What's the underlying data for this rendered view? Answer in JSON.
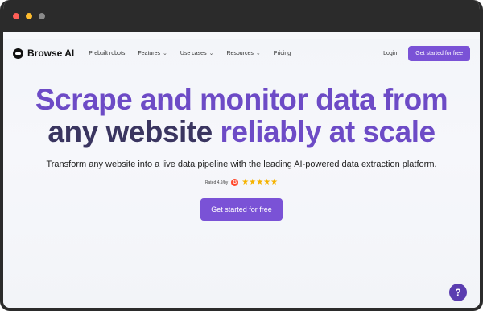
{
  "brand": {
    "name": "Browse AI",
    "icon": "browse-ai-logo-icon"
  },
  "nav": {
    "items": [
      {
        "label": "Prebuilt robots",
        "dropdown": false
      },
      {
        "label": "Features",
        "dropdown": true
      },
      {
        "label": "Use cases",
        "dropdown": true
      },
      {
        "label": "Resources",
        "dropdown": true
      },
      {
        "label": "Pricing",
        "dropdown": false
      }
    ],
    "login": "Login",
    "cta": "Get started for free"
  },
  "hero": {
    "line1": "Scrape and monitor data from",
    "line2_part1": "any website",
    "line2_part2": "reliably at scale",
    "subtitle": "Transform any website into a live data pipeline with the leading AI-powered data extraction platform.",
    "rating_text": "Rated 4.9/by",
    "rating_badge": "G",
    "rating_stars": 5,
    "cta": "Get started for free"
  },
  "help_label": "?",
  "colors": {
    "accent": "#7a52d6",
    "heading_purple": "#6d4bc6",
    "heading_dark": "#3a3560",
    "star": "#f5b301"
  }
}
